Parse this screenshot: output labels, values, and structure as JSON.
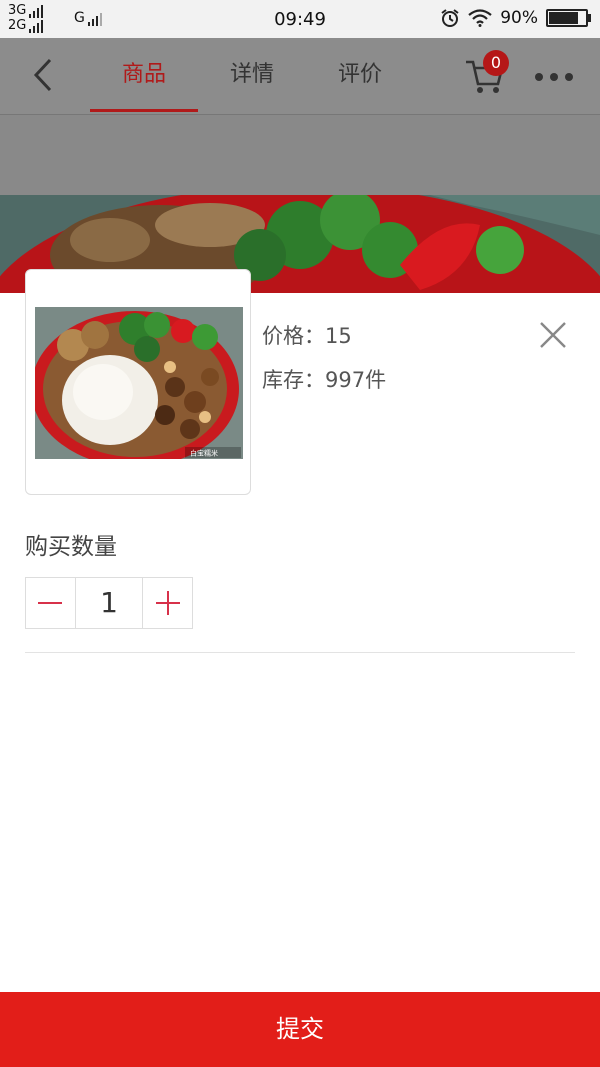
{
  "status_bar": {
    "network_top": "3G",
    "network_bottom": "2G",
    "network_g": "G",
    "time": "09:49",
    "battery": "90%",
    "battery_level": 0.9
  },
  "header": {
    "tabs": [
      {
        "label": "商品",
        "active": true
      },
      {
        "label": "详情",
        "active": false
      },
      {
        "label": "评价",
        "active": false
      }
    ],
    "cart_count": "0",
    "icons": {
      "back": "chevron-left-icon",
      "cart": "cart-icon",
      "more": "more-dots-icon"
    }
  },
  "product": {
    "price": "价格：15",
    "stock": "库存：997件",
    "image_watermark": "白宝糯米"
  },
  "quantity": {
    "label": "购买数量",
    "value": "1"
  },
  "footer": {
    "submit_label": "提交"
  },
  "colors": {
    "accent_red": "#e21e19",
    "tab_active": "#b01a1a",
    "stepper_sign": "#d7314a"
  }
}
